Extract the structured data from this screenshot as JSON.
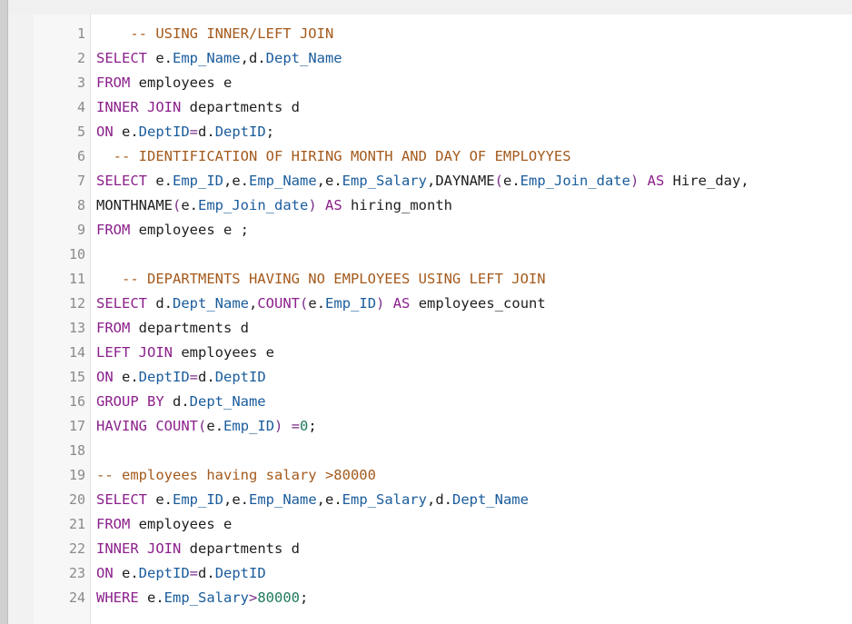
{
  "editor": {
    "lines": [
      {
        "n": "1",
        "tokens": [
          {
            "t": "    -- USING INNER/LEFT JOIN",
            "c": "cm"
          }
        ]
      },
      {
        "n": "2",
        "tokens": [
          {
            "t": "SELECT",
            "c": "kw"
          },
          {
            "t": " e.",
            "c": "pl"
          },
          {
            "t": "Emp_Name",
            "c": "id"
          },
          {
            "t": ",d.",
            "c": "pl"
          },
          {
            "t": "Dept_Name",
            "c": "id"
          }
        ]
      },
      {
        "n": "3",
        "tokens": [
          {
            "t": "FROM",
            "c": "kw"
          },
          {
            "t": " employees e",
            "c": "pl"
          }
        ]
      },
      {
        "n": "4",
        "tokens": [
          {
            "t": "INNER JOIN",
            "c": "kw"
          },
          {
            "t": " departments d",
            "c": "pl"
          }
        ]
      },
      {
        "n": "5",
        "tokens": [
          {
            "t": "ON",
            "c": "kw"
          },
          {
            "t": " e.",
            "c": "pl"
          },
          {
            "t": "DeptID",
            "c": "id"
          },
          {
            "t": "=",
            "c": "op"
          },
          {
            "t": "d.",
            "c": "pl"
          },
          {
            "t": "DeptID",
            "c": "id"
          },
          {
            "t": ";",
            "c": "pl"
          }
        ]
      },
      {
        "n": "6",
        "tokens": [
          {
            "t": "  -- IDENTIFICATION OF HIRING MONTH AND DAY OF EMPLOYYES",
            "c": "cm"
          }
        ]
      },
      {
        "n": "7",
        "tokens": [
          {
            "t": "SELECT",
            "c": "kw"
          },
          {
            "t": " e.",
            "c": "pl"
          },
          {
            "t": "Emp_ID",
            "c": "id"
          },
          {
            "t": ",e.",
            "c": "pl"
          },
          {
            "t": "Emp_Name",
            "c": "id"
          },
          {
            "t": ",e.",
            "c": "pl"
          },
          {
            "t": "Emp_Salary",
            "c": "id"
          },
          {
            "t": ",DAYNAME",
            "c": "pl"
          },
          {
            "t": "(",
            "c": "op"
          },
          {
            "t": "e.",
            "c": "pl"
          },
          {
            "t": "Emp_Join_date",
            "c": "id"
          },
          {
            "t": ")",
            "c": "op"
          },
          {
            "t": " AS",
            "c": "kw"
          },
          {
            "t": " Hire_day,",
            "c": "pl"
          }
        ]
      },
      {
        "n": "8",
        "tokens": [
          {
            "t": "MONTHNAME",
            "c": "pl"
          },
          {
            "t": "(",
            "c": "op"
          },
          {
            "t": "e.",
            "c": "pl"
          },
          {
            "t": "Emp_Join_date",
            "c": "id"
          },
          {
            "t": ")",
            "c": "op"
          },
          {
            "t": " AS",
            "c": "kw"
          },
          {
            "t": " hiring_month",
            "c": "pl"
          }
        ]
      },
      {
        "n": "9",
        "tokens": [
          {
            "t": "FROM",
            "c": "kw"
          },
          {
            "t": " employees e ;",
            "c": "pl"
          }
        ]
      },
      {
        "n": "10",
        "tokens": []
      },
      {
        "n": "11",
        "tokens": [
          {
            "t": "   -- DEPARTMENTS HAVING NO EMPLOYEES USING LEFT JOIN",
            "c": "cm"
          }
        ]
      },
      {
        "n": "12",
        "tokens": [
          {
            "t": "SELECT",
            "c": "kw"
          },
          {
            "t": " d.",
            "c": "pl"
          },
          {
            "t": "Dept_Name",
            "c": "id"
          },
          {
            "t": ",",
            "c": "pl"
          },
          {
            "t": "COUNT",
            "c": "kw"
          },
          {
            "t": "(",
            "c": "op"
          },
          {
            "t": "e.",
            "c": "pl"
          },
          {
            "t": "Emp_ID",
            "c": "id"
          },
          {
            "t": ")",
            "c": "op"
          },
          {
            "t": " AS",
            "c": "kw"
          },
          {
            "t": " employees_count",
            "c": "pl"
          }
        ]
      },
      {
        "n": "13",
        "tokens": [
          {
            "t": "FROM",
            "c": "kw"
          },
          {
            "t": " departments d",
            "c": "pl"
          }
        ]
      },
      {
        "n": "14",
        "tokens": [
          {
            "t": "LEFT JOIN",
            "c": "kw"
          },
          {
            "t": " employees e",
            "c": "pl"
          }
        ]
      },
      {
        "n": "15",
        "tokens": [
          {
            "t": "ON",
            "c": "kw"
          },
          {
            "t": " e.",
            "c": "pl"
          },
          {
            "t": "DeptID",
            "c": "id"
          },
          {
            "t": "=",
            "c": "op"
          },
          {
            "t": "d.",
            "c": "pl"
          },
          {
            "t": "DeptID",
            "c": "id"
          }
        ]
      },
      {
        "n": "16",
        "tokens": [
          {
            "t": "GROUP BY",
            "c": "kw"
          },
          {
            "t": " d.",
            "c": "pl"
          },
          {
            "t": "Dept_Name",
            "c": "id"
          }
        ]
      },
      {
        "n": "17",
        "tokens": [
          {
            "t": "HAVING",
            "c": "kw"
          },
          {
            "t": " ",
            "c": "pl"
          },
          {
            "t": "COUNT",
            "c": "kw"
          },
          {
            "t": "(",
            "c": "op"
          },
          {
            "t": "e.",
            "c": "pl"
          },
          {
            "t": "Emp_ID",
            "c": "id"
          },
          {
            "t": ")",
            "c": "op"
          },
          {
            "t": " =",
            "c": "op"
          },
          {
            "t": "0",
            "c": "num"
          },
          {
            "t": ";",
            "c": "pl"
          }
        ]
      },
      {
        "n": "18",
        "tokens": []
      },
      {
        "n": "19",
        "tokens": [
          {
            "t": "-- employees having salary >80000",
            "c": "cm"
          }
        ]
      },
      {
        "n": "20",
        "tokens": [
          {
            "t": "SELECT",
            "c": "kw"
          },
          {
            "t": " e.",
            "c": "pl"
          },
          {
            "t": "Emp_ID",
            "c": "id"
          },
          {
            "t": ",e.",
            "c": "pl"
          },
          {
            "t": "Emp_Name",
            "c": "id"
          },
          {
            "t": ",e.",
            "c": "pl"
          },
          {
            "t": "Emp_Salary",
            "c": "id"
          },
          {
            "t": ",d.",
            "c": "pl"
          },
          {
            "t": "Dept_Name",
            "c": "id"
          }
        ]
      },
      {
        "n": "21",
        "tokens": [
          {
            "t": "FROM",
            "c": "kw"
          },
          {
            "t": " employees e",
            "c": "pl"
          }
        ]
      },
      {
        "n": "22",
        "tokens": [
          {
            "t": "INNER JOIN",
            "c": "kw"
          },
          {
            "t": " departments d",
            "c": "pl"
          }
        ]
      },
      {
        "n": "23",
        "tokens": [
          {
            "t": "ON",
            "c": "kw"
          },
          {
            "t": " e.",
            "c": "pl"
          },
          {
            "t": "DeptID",
            "c": "id"
          },
          {
            "t": "=",
            "c": "op"
          },
          {
            "t": "d.",
            "c": "pl"
          },
          {
            "t": "DeptID",
            "c": "id"
          }
        ]
      },
      {
        "n": "24",
        "tokens": [
          {
            "t": "WHERE",
            "c": "kw"
          },
          {
            "t": " e.",
            "c": "pl"
          },
          {
            "t": "Emp_Salary",
            "c": "id"
          },
          {
            "t": ">",
            "c": "op"
          },
          {
            "t": "80000",
            "c": "num"
          },
          {
            "t": ";",
            "c": "pl"
          }
        ]
      }
    ]
  },
  "colors": {
    "keyword": "#8b1f8b",
    "identifier": "#1a5c9c",
    "comment": "#a45a1c",
    "operator": "#7a2f8a",
    "number": "#1e7a5c",
    "plain": "#1e1e1e",
    "line_number": "#8a8a8a",
    "gutter_bg": "#f7f7f7"
  }
}
